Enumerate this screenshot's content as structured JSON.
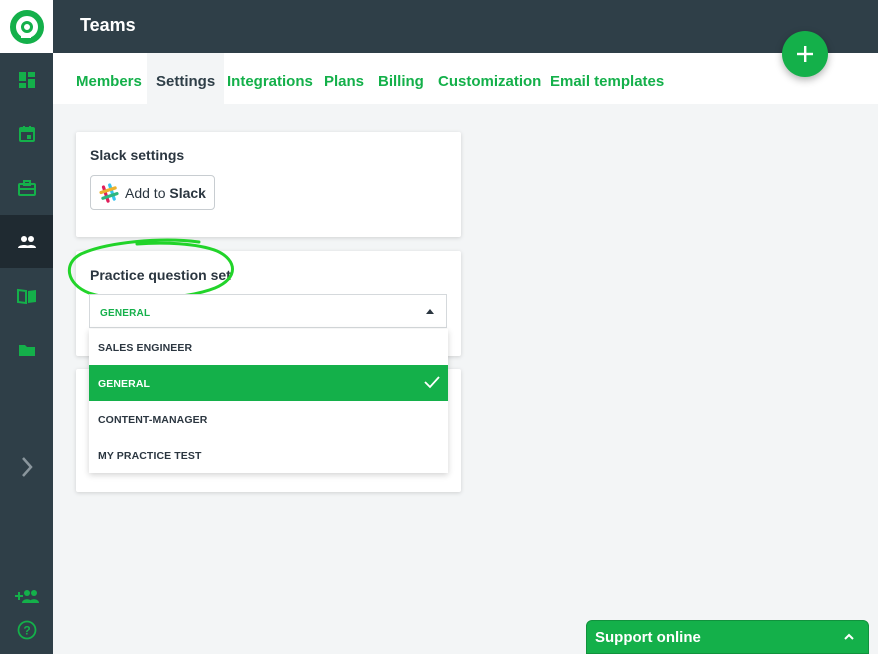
{
  "app": {
    "logo_icon": "logo-icon",
    "accent_color": "#14b04a",
    "sidebar_color": "#2f3f48"
  },
  "header": {
    "title": "Teams"
  },
  "sidebar": {
    "items": [
      {
        "icon": "dashboard-icon"
      },
      {
        "icon": "calendar-icon"
      },
      {
        "icon": "briefcase-icon"
      },
      {
        "icon": "people-icon",
        "active": true
      },
      {
        "icon": "book-icon"
      },
      {
        "icon": "folder-icon"
      },
      {
        "icon": "chevron-right-icon"
      },
      {
        "icon": "add-person-icon"
      },
      {
        "icon": "help-icon"
      }
    ]
  },
  "tabs": [
    {
      "label": "Members"
    },
    {
      "label": "Settings",
      "active": true
    },
    {
      "label": "Integrations"
    },
    {
      "label": "Plans"
    },
    {
      "label": "Billing"
    },
    {
      "label": "Customization"
    },
    {
      "label": "Email templates"
    }
  ],
  "fab": {
    "icon": "plus-icon"
  },
  "slack_card": {
    "title": "Slack settings",
    "button_prefix": "Add to",
    "button_brand": "Slack"
  },
  "practice_card": {
    "title": "Practice question set",
    "selected": "GENERAL",
    "options": [
      {
        "label": "SALES ENGINEER"
      },
      {
        "label": "GENERAL",
        "selected": true
      },
      {
        "label": "CONTENT-MANAGER"
      },
      {
        "label": "MY PRACTICE TEST"
      }
    ]
  },
  "support": {
    "label": "Support online"
  }
}
